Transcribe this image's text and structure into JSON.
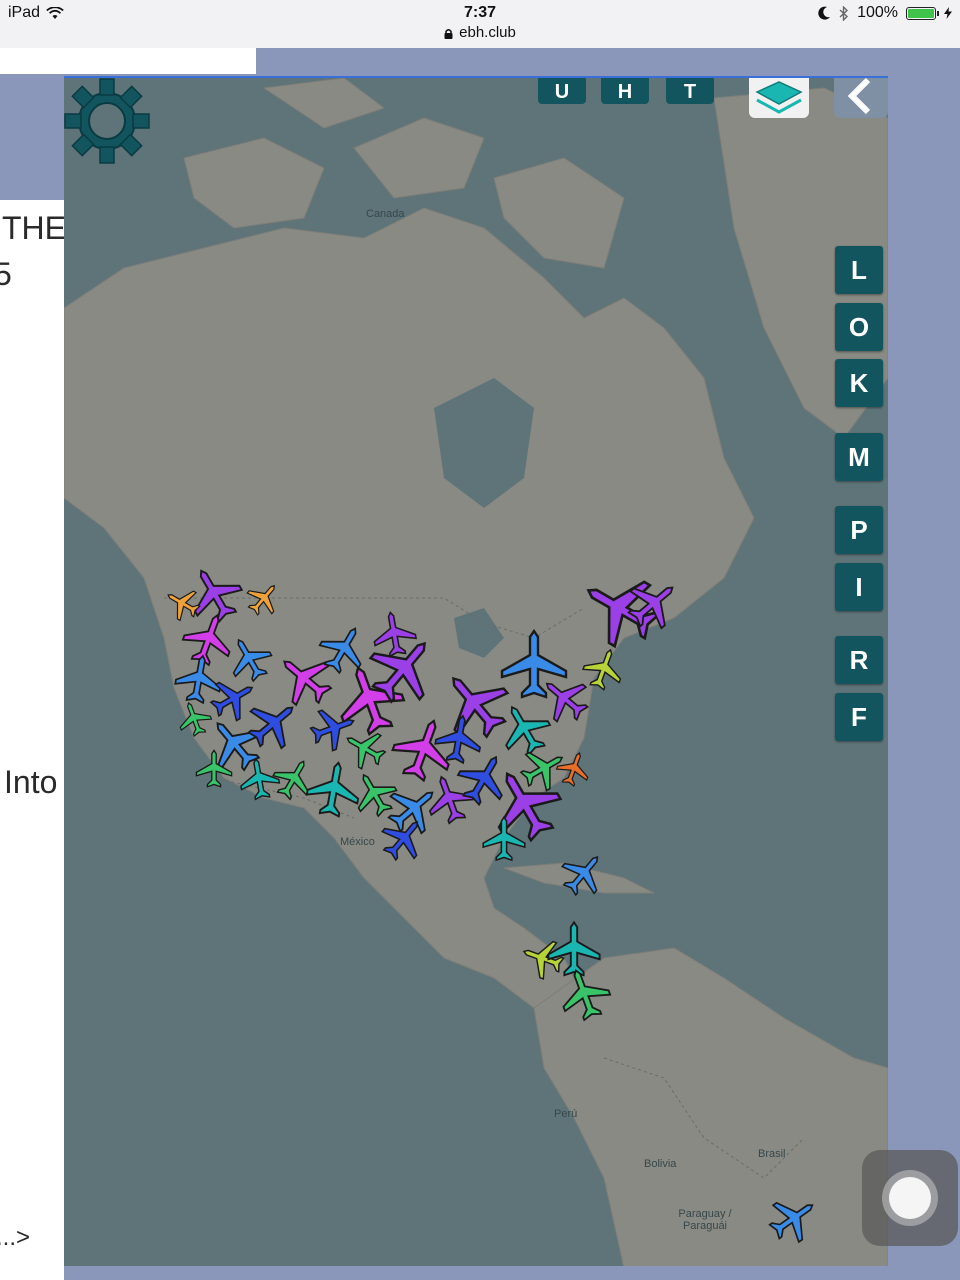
{
  "status_bar": {
    "device": "iPad",
    "time": "7:37",
    "url": "ebh.club",
    "battery": "100%",
    "icons": [
      "wifi-icon",
      "moon-icon",
      "bluetooth-icon",
      "battery-icon",
      "lock-icon"
    ]
  },
  "left_fragments": [
    "THE",
    "5",
    "Into",
    "...>"
  ],
  "map": {
    "top_buttons": [
      "U",
      "H",
      "T"
    ],
    "side_buttons": [
      "L",
      "O",
      "K",
      "M",
      "P",
      "I",
      "R",
      "F"
    ],
    "labels": [
      "Canada",
      "México",
      "Perú",
      "Bolivia",
      "Brasil",
      "Paraguay / Paraguái"
    ],
    "colors": {
      "ocean": "#5f7479",
      "land": "#8a8a84",
      "button": "#12555f",
      "plane_colors": [
        "#9b3fe6",
        "#d23ee8",
        "#3a8be8",
        "#2f4de0",
        "#1ab6b2",
        "#39c46a",
        "#b6d43a",
        "#f0a23a",
        "#e86f2a"
      ]
    }
  }
}
